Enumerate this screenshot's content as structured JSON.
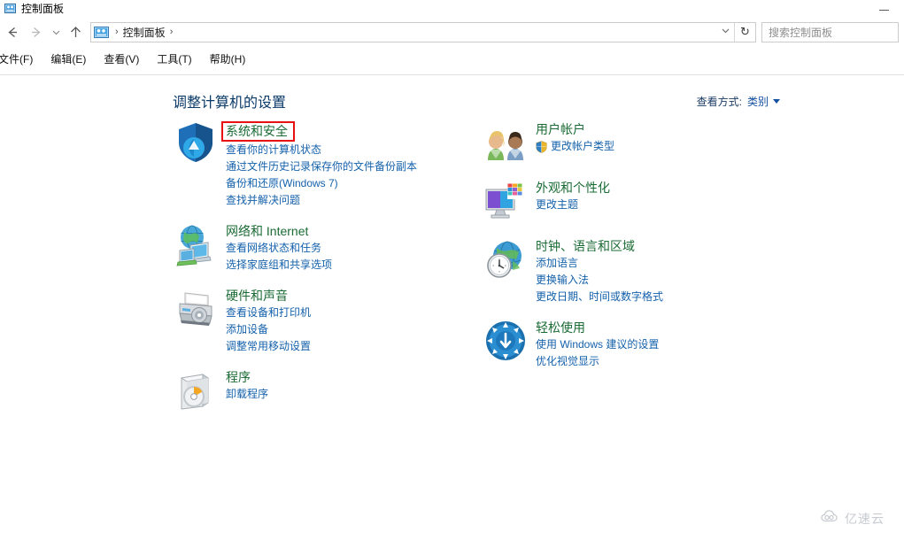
{
  "window": {
    "title": "控制面板",
    "icon": "control-panel-icon",
    "minimize_label": "—"
  },
  "navbar": {
    "back_icon": "back-arrow-icon",
    "forward_icon": "forward-arrow-icon",
    "recent_icon": "chevron-down-icon",
    "up_icon": "up-arrow-icon",
    "breadcrumb": {
      "icon": "control-panel-icon",
      "separator": "›",
      "path": "控制面板",
      "trailing_separator": "›"
    },
    "dropdown_icon": "chevron-down-icon",
    "refresh_icon": "refresh-icon",
    "refresh_glyph": "↻",
    "search": {
      "placeholder": "搜索控制面板",
      "value": ""
    }
  },
  "menubar": {
    "items": [
      {
        "label": "文件(F)"
      },
      {
        "label": "编辑(E)"
      },
      {
        "label": "查看(V)"
      },
      {
        "label": "工具(T)"
      },
      {
        "label": "帮助(H)"
      }
    ]
  },
  "main": {
    "heading": "调整计算机的设置",
    "view_by": {
      "label": "查看方式:",
      "value": "类别",
      "caret_icon": "chevron-down-icon"
    }
  },
  "colors": {
    "category_title": "#1a6b34",
    "link": "#1461ab",
    "heading": "#0a3a68",
    "highlight_box": "#e81010"
  },
  "categories": {
    "left": [
      {
        "title": "系统和安全",
        "icon": "shield-security-icon",
        "highlighted": true,
        "links": [
          {
            "label": "查看你的计算机状态",
            "shield": false
          },
          {
            "label": "通过文件历史记录保存你的文件备份副本",
            "shield": false
          },
          {
            "label": "备份和还原(Windows 7)",
            "shield": false
          },
          {
            "label": "查找并解决问题",
            "shield": false
          }
        ]
      },
      {
        "title": "网络和 Internet",
        "icon": "network-globe-icon",
        "highlighted": false,
        "links": [
          {
            "label": "查看网络状态和任务",
            "shield": false
          },
          {
            "label": "选择家庭组和共享选项",
            "shield": false
          }
        ]
      },
      {
        "title": "硬件和声音",
        "icon": "printer-hardware-icon",
        "highlighted": false,
        "links": [
          {
            "label": "查看设备和打印机",
            "shield": false
          },
          {
            "label": "添加设备",
            "shield": false
          },
          {
            "label": "调整常用移动设置",
            "shield": false
          }
        ]
      },
      {
        "title": "程序",
        "icon": "programs-disc-icon",
        "highlighted": false,
        "links": [
          {
            "label": "卸载程序",
            "shield": false
          }
        ]
      }
    ],
    "right": [
      {
        "title": "用户帐户",
        "icon": "user-accounts-icon",
        "highlighted": false,
        "links": [
          {
            "label": "更改帐户类型",
            "shield": true
          }
        ]
      },
      {
        "title": "外观和个性化",
        "icon": "appearance-monitor-icon",
        "highlighted": false,
        "links": [
          {
            "label": "更改主题",
            "shield": false
          }
        ]
      },
      {
        "title": "时钟、语言和区域",
        "icon": "clock-globe-icon",
        "highlighted": false,
        "links": [
          {
            "label": "添加语言",
            "shield": false
          },
          {
            "label": "更换输入法",
            "shield": false
          },
          {
            "label": "更改日期、时间或数字格式",
            "shield": false
          }
        ]
      },
      {
        "title": "轻松使用",
        "icon": "ease-of-access-icon",
        "highlighted": false,
        "links": [
          {
            "label": "使用 Windows 建议的设置",
            "shield": false
          },
          {
            "label": "优化视觉显示",
            "shield": false
          }
        ]
      }
    ]
  },
  "watermark": {
    "text": "亿速云",
    "icon": "cloud-logo-icon"
  }
}
